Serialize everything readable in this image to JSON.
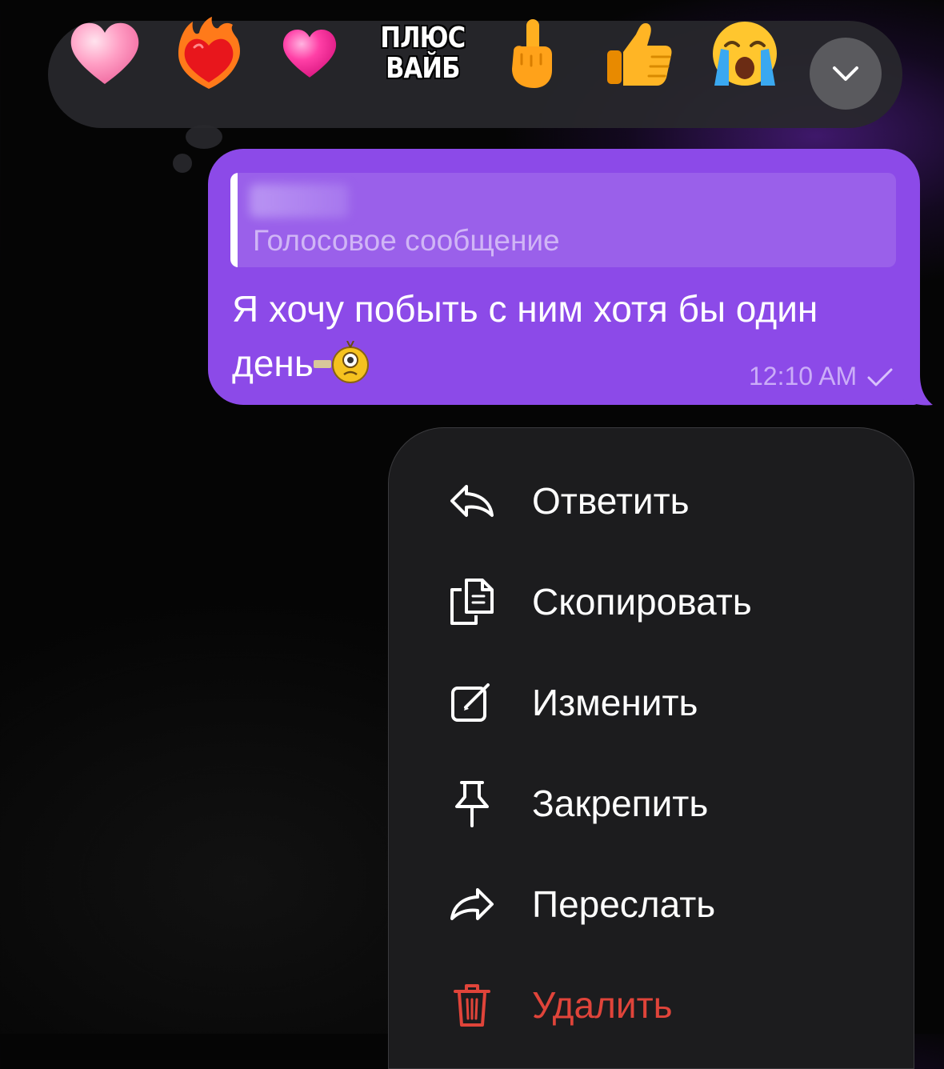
{
  "reactions": {
    "items": [
      {
        "name": "pink-heart",
        "icon": "pink-heart-icon"
      },
      {
        "name": "heart-on-fire",
        "icon": "heart-on-fire-icon"
      },
      {
        "name": "magenta-heart",
        "icon": "magenta-heart-icon"
      },
      {
        "name": "sticker",
        "line1": "ПЛЮС",
        "line2": "ВАЙБ"
      },
      {
        "name": "middle-finger",
        "icon": "middle-finger-icon"
      },
      {
        "name": "thumbs-up",
        "icon": "thumbs-up-icon"
      },
      {
        "name": "crying-face",
        "icon": "crying-face-icon"
      }
    ],
    "collapse_icon": "chevron-down-icon"
  },
  "message": {
    "reply_preview": "Голосовое сообщение",
    "text_line1": "Я хочу побыть с ним хотя бы один",
    "text_line2": "день",
    "time": "12:10 AM",
    "status_icon": "check-icon",
    "bubble_color": "#8c4ae8"
  },
  "menu": {
    "items": [
      {
        "label": "Ответить",
        "icon": "reply-icon"
      },
      {
        "label": "Скопировать",
        "icon": "copy-icon"
      },
      {
        "label": "Изменить",
        "icon": "edit-icon"
      },
      {
        "label": "Закрепить",
        "icon": "pin-icon"
      },
      {
        "label": "Переслать",
        "icon": "forward-icon"
      },
      {
        "label": "Удалить",
        "icon": "trash-icon",
        "color": "#e0443a"
      }
    ]
  }
}
